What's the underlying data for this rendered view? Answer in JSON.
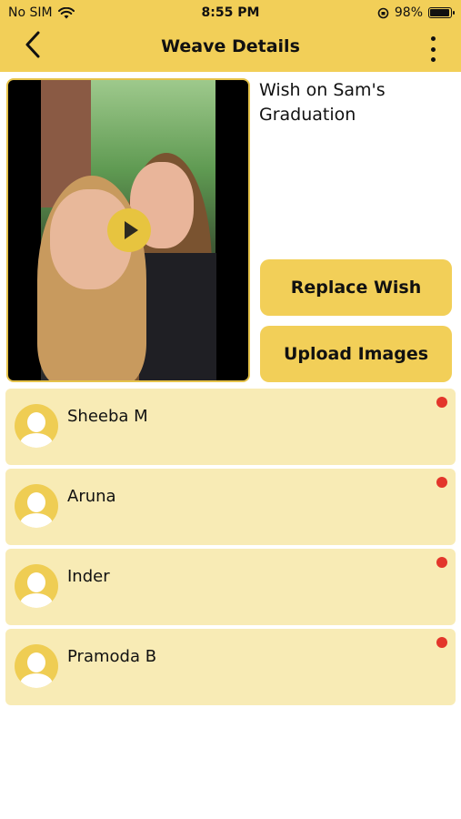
{
  "status_bar": {
    "carrier": "No SIM",
    "time": "8:55 PM",
    "battery": "98%",
    "battery_level": 0.98
  },
  "header": {
    "title": "Weave Details",
    "back_icon": "chevron-left-icon",
    "more_icon": "vertical-ellipsis-icon"
  },
  "wish": {
    "title": "Wish on Sam's Graduation",
    "play_icon": "play-icon"
  },
  "actions": {
    "replace_label": "Replace Wish",
    "upload_label": "Upload Images"
  },
  "contributors": [
    {
      "name": "Sheeba M",
      "status_color": "#e3362b"
    },
    {
      "name": "Aruna",
      "status_color": "#e3362b"
    },
    {
      "name": "Inder",
      "status_color": "#e3362b"
    },
    {
      "name": "Pramoda B",
      "status_color": "#e3362b"
    }
  ],
  "colors": {
    "accent": "#f2cf58",
    "row_background": "#f8ebb5",
    "status_dot": "#e3362b"
  }
}
